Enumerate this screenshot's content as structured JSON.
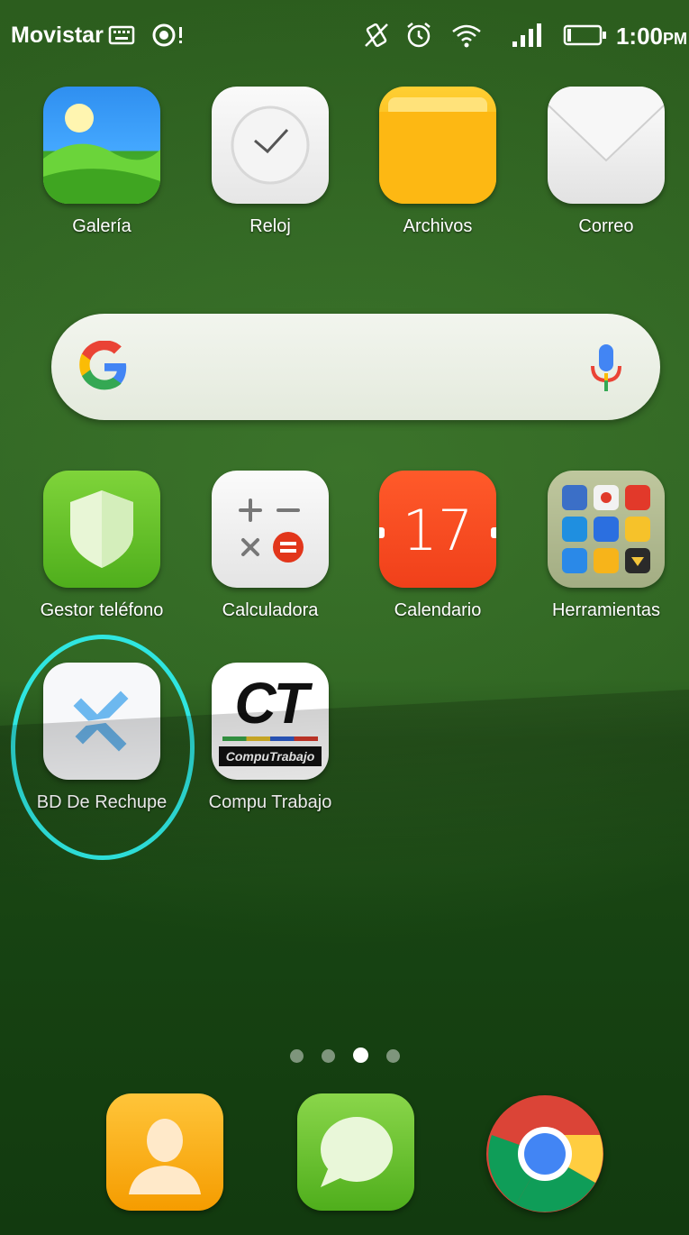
{
  "status_bar": {
    "carrier": "Movistar",
    "time": "1:00",
    "ampm": "PM",
    "icons": [
      "keyboard-icon",
      "sync-alert-icon",
      "vibrate-icon",
      "alarm-icon",
      "wifi-icon",
      "signal-icon",
      "battery-icon"
    ]
  },
  "home": {
    "row1": [
      {
        "label": "Galería",
        "icon": "gallery-icon"
      },
      {
        "label": "Reloj",
        "icon": "clock-icon"
      },
      {
        "label": "Archivos",
        "icon": "folder-icon"
      },
      {
        "label": "Correo",
        "icon": "mail-icon"
      }
    ],
    "search": {
      "icon": "google-g-icon",
      "mic_icon": "mic-icon"
    },
    "row2": [
      {
        "label": "Gestor teléfono",
        "icon": "shield-icon"
      },
      {
        "label": "Calculadora",
        "icon": "calculator-icon"
      },
      {
        "label": "Calendario",
        "icon": "calendar-icon",
        "day": "17"
      },
      {
        "label": "Herramientas",
        "icon": "tools-folder-icon"
      }
    ],
    "row3": [
      {
        "label": "BD De Rechupe",
        "icon": "bd-rechupe-icon"
      },
      {
        "label": "Compu Trabajo",
        "icon": "computrabajo-icon",
        "logo_text": "CT",
        "logo_subtext": "CompuTrabajo"
      }
    ]
  },
  "page_indicator": {
    "count": 4,
    "active": 3
  },
  "dock": [
    {
      "icon": "contacts-icon"
    },
    {
      "icon": "messages-icon"
    },
    {
      "icon": "chrome-icon"
    }
  ],
  "colors": {
    "highlight": "#2fe6e0",
    "wallpaper": "#2c5d1e"
  }
}
